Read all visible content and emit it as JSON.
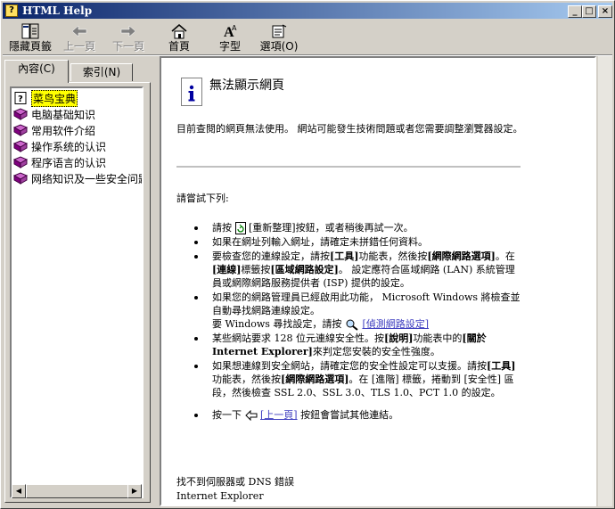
{
  "window": {
    "title": "HTML Help"
  },
  "toolbar": {
    "hide_label": "隱藏頁籤",
    "back_label": "上一頁",
    "forward_label": "下一頁",
    "home_label": "首頁",
    "font_label": "字型",
    "options_label": "選項(O)"
  },
  "tabs": {
    "contents": "內容(C)",
    "index": "索引(N)"
  },
  "tree": {
    "items": [
      "菜鸟宝典",
      "电脑基础知识",
      "常用软件介绍",
      "操作系统的认识",
      "程序语言的认识",
      "网络知识及一些安全问题"
    ]
  },
  "page": {
    "title": "無法顯示網頁",
    "intro": "目前查閱的網頁無法使用。 網站可能發生技術問題或者您需要調整瀏覽器設定。",
    "try": "請嘗試下列:",
    "b1a": "請按",
    "b1b": "[重新整理]按鈕，或者稍後再試一次。",
    "b2": "如果在網址列輸入網址，請確定未拼錯任何資料。",
    "b3a": "要檢查您的連線設定，請按",
    "b3b": "[工具]",
    "b3c": "功能表，然後按",
    "b3d": "[網際網路選項]",
    "b3e": "。在",
    "b3f": "[連線]",
    "b3g": "標籤按",
    "b3h": "[區域網路設定]",
    "b3i": "。 設定應符合區域網路 (LAN) 系統管理員或網際網路服務提供者 (ISP) 提供的設定。",
    "b4a": "如果您的網路管理員已經啟用此功能， Microsoft Windows 將檢查並自動尋找網路連線設定。",
    "b4b": "要 Windows 尋找設定，請按",
    "b4c": "[偵測網路設定]",
    "b5a": "某些網站要求 128 位元連線安全性。按",
    "b5b": "[說明]",
    "b5c": "功能表中的",
    "b5d": "[關於 Internet Explorer]",
    "b5e": "來判定您安裝的安全性強度。",
    "b6a": "如果想連線到安全網站，請確定您的安全性設定可以支援。請按",
    "b6b": "[工具]",
    "b6c": "功能表，然後按",
    "b6d": "[網際網路選項]",
    "b6e": "。在 [進階] 標籤，捲動到 [安全性] 區段，然後檢查 SSL 2.0、SSL 3.0、TLS 1.0、PCT 1.0 的設定。",
    "b7a": "按一下",
    "b7b": "[上一頁]",
    "b7c": "按鈕會嘗試其他連結。",
    "footer1": "找不到伺服器或 DNS 錯誤",
    "footer2": "Internet Explorer"
  }
}
